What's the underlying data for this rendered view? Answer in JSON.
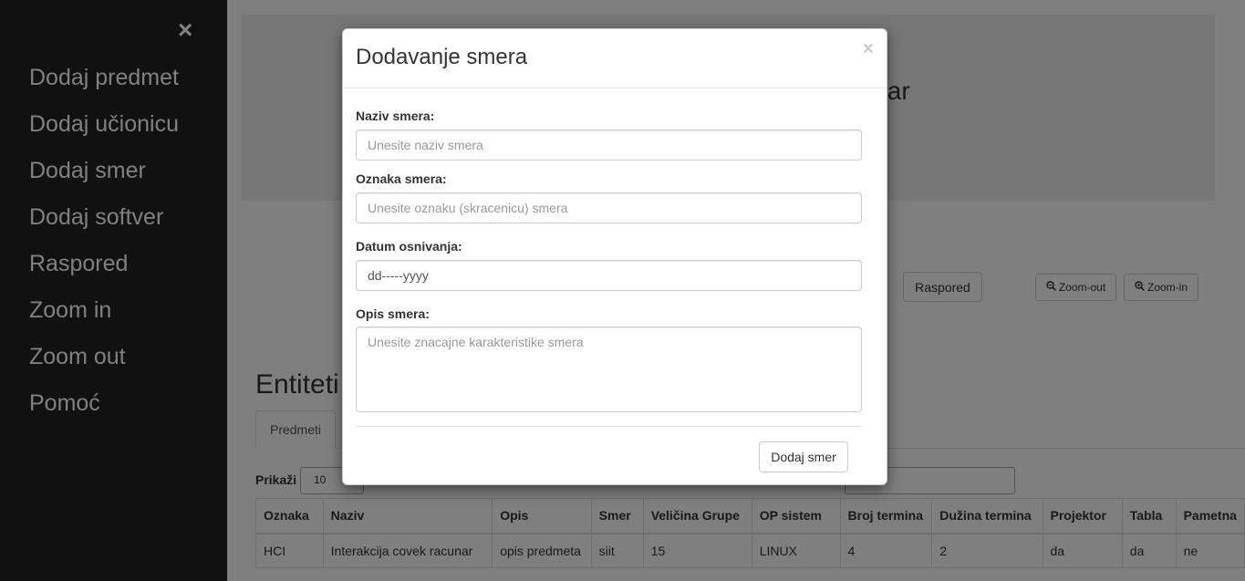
{
  "sidenav": {
    "close_symbol": "×",
    "items": [
      {
        "label": "Dodaj predmet"
      },
      {
        "label": "Dodaj učionicu"
      },
      {
        "label": "Dodaj smer"
      },
      {
        "label": "Dodaj softver"
      },
      {
        "label": "Raspored"
      },
      {
        "label": "Zoom in"
      },
      {
        "label": "Zoom out"
      },
      {
        "label": "Pomoć"
      }
    ]
  },
  "background": {
    "jumbotron_title_fragment": "tar",
    "raspored_button": "Raspored",
    "zoom_out_button": "Zoom-out",
    "zoom_in_button": "Zoom-in",
    "zoom_icon": "magnifier-icon",
    "entities_heading": "Entiteti",
    "tabs": [
      {
        "label": "Predmeti"
      }
    ],
    "show_label": "Prikaži",
    "page_length_value": "10",
    "table": {
      "headers": [
        "Oznaka",
        "Naziv",
        "Opis",
        "Smer",
        "Veličina Grupe",
        "OP sistem",
        "Broj termina",
        "Dužina termina",
        "Projektor",
        "Tabla",
        "Pametna"
      ],
      "rows": [
        [
          "HCI",
          "Interakcija covek racunar",
          "opis predmeta",
          "siit",
          "15",
          "LINUX",
          "4",
          "2",
          "da",
          "da",
          "ne"
        ]
      ]
    }
  },
  "modal": {
    "title": "Dodavanje smera",
    "close_symbol": "×",
    "fields": {
      "naziv": {
        "label": "Naziv smera:",
        "placeholder": "Unesite naziv smera"
      },
      "oznaka": {
        "label": "Oznaka smera:",
        "placeholder": "Unesite oznaku (skracenicu) smera"
      },
      "datum": {
        "label": "Datum osnivanja:",
        "value": "dd-----yyyy"
      },
      "opis": {
        "label": "Opis smera:",
        "placeholder": "Unesite znacajne karakteristike smera"
      }
    },
    "submit_button": "Dodaj smer"
  },
  "colors": {
    "sidenav_bg": "#111111",
    "sidenav_text": "#818181",
    "overlay": "rgba(0,0,0,0.5)",
    "jumbotron_bg": "#eeeeee"
  }
}
